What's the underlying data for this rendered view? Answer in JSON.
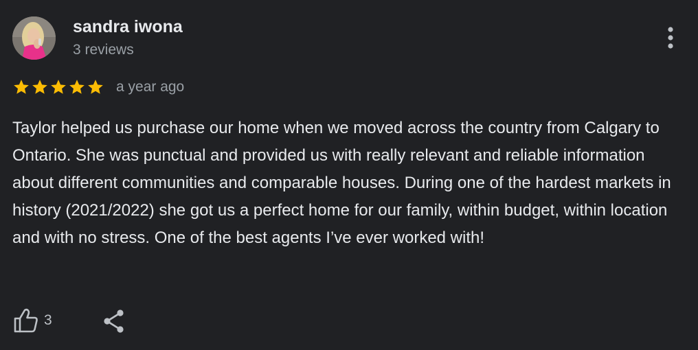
{
  "reviewer": {
    "name": "sandra iwona",
    "review_count": "3 reviews",
    "avatar_icon": "person-photo"
  },
  "review": {
    "rating": 5,
    "rating_max": 5,
    "star_color": "#fbbc04",
    "date": "a year ago",
    "text": "Taylor helped us purchase our home when we moved across the country from Calgary to Ontario. She was punctual and provided us with really relevant and reliable information about different communities and comparable houses. During one of the hardest markets in history (2021/2022) she got us a perfect home for our family, within budget, within location and with no stress. One of the best agents I’ve ever worked with!"
  },
  "actions": {
    "like_count": "3",
    "like_icon": "thumbs-up-icon",
    "share_icon": "share-icon",
    "more_icon": "more-vert-icon"
  },
  "colors": {
    "background": "#202124",
    "text_primary": "#e8eaed",
    "text_secondary": "#9aa0a6"
  }
}
